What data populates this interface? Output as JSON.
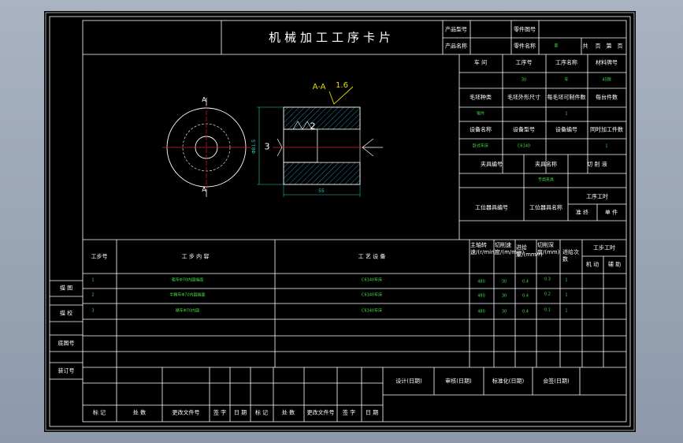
{
  "title": "机械加工工序卡片",
  "header": {
    "product_model_label": "产品型号",
    "part_drawing_no_label": "零件图号",
    "product_name_label": "产品名称",
    "part_name_label": "零件名称",
    "part_name_value": "套",
    "total_pages_label": "共",
    "page_label": "页",
    "sheet_label": "第",
    "sheet_page_label": "页"
  },
  "info": {
    "workshop_label": "车  间",
    "process_no_label": "工序号",
    "process_name_label": "工序名称",
    "material_grade_label": "材料牌号",
    "process_no_value": "30",
    "process_name_value": "车",
    "material_grade_value": "45钢",
    "blank_type_label": "毛坯种类",
    "blank_size_label": "毛坯外形尺寸",
    "parts_per_blank_label": "每毛坯可制件数",
    "parts_per_unit_label": "每台件数",
    "blank_type_value": "锻件",
    "parts_per_blank_value": "1",
    "equipment_name_label": "设备名称",
    "equipment_model_label": "设备型号",
    "equipment_no_label": "设备编号",
    "simultaneous_parts_label": "同时加工件数",
    "equipment_name_value": "卧式车床",
    "equipment_model_value": "C6140",
    "simultaneous_parts_value": "1",
    "fixture_no_label": "夹具编号",
    "fixture_name_label": "夹具名称",
    "coolant_label": "切 削 液",
    "fixture_name_value": "专用夹具",
    "station_tool_no_label": "工位器具编号",
    "station_tool_name_label": "工位器具名称",
    "process_hours_label": "工序工时",
    "prep_label": "准 终",
    "unit_label": "单 件"
  },
  "drawing": {
    "section_label": "A-A",
    "roughness": "1.6",
    "marker_a": "A",
    "label_3": "3",
    "label_2": "2",
    "dim_diameter": "Φ81.5",
    "dim_length": "55"
  },
  "steps_header": {
    "step_no": "工步号",
    "step_content": "工  步  内  容",
    "equipment": "工  艺  设  备",
    "spindle_speed": "主轴转速/(r/min)",
    "cutting_speed": "切削速度/(m/min)",
    "feed": "进给量/(mm/r)",
    "depth": "切削深度/(mm)",
    "passes": "进给次数",
    "step_hours": "工步工时",
    "machine_time": "机 动",
    "aux_time": "辅 助"
  },
  "steps": [
    {
      "no": "1",
      "content": "粗车Φ70内圆端面",
      "equipment": "C6140车床",
      "speed": "480",
      "cut": "30",
      "feed": "0.4",
      "depth": "0.3",
      "passes": "1"
    },
    {
      "no": "2",
      "content": "半精车Φ70内圆端面",
      "equipment": "C6140车床",
      "speed": "480",
      "cut": "30",
      "feed": "0.4",
      "depth": "0.2",
      "passes": "1"
    },
    {
      "no": "3",
      "content": "精车Φ70内圆",
      "equipment": "C6140车床",
      "speed": "480",
      "cut": "30",
      "feed": "0.4",
      "depth": "0.1",
      "passes": "1"
    }
  ],
  "side": {
    "trace_label": "描 图",
    "check_label": "描 校",
    "base_no_label": "底图号",
    "binding_no_label": "装订号"
  },
  "signoff": {
    "design_label": "设计(日期)",
    "review_label": "审核(日期)",
    "standard_label": "标准化(日期)",
    "approve_label": "会签(日期)"
  },
  "revision": {
    "mark": "标 记",
    "count": "处 数",
    "doc_no": "更改文件号",
    "sign": "签 字",
    "date": "日 期"
  }
}
